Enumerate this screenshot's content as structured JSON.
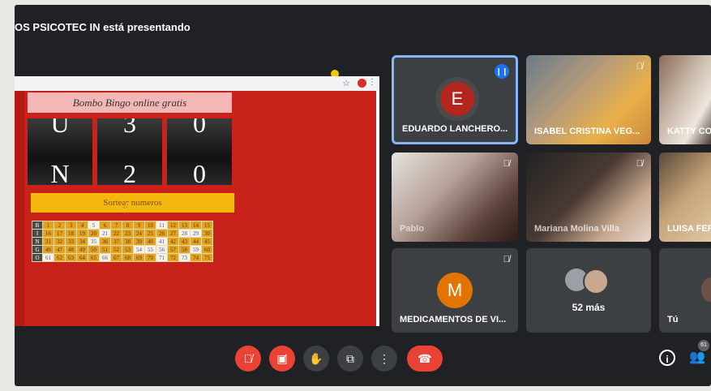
{
  "meet": {
    "presenting_text": "OS PSICOTEC IN está presentando",
    "people_count": "61"
  },
  "bingo": {
    "title": "Bombo Bingo online gratis",
    "balls_top": [
      "U",
      "3",
      "0"
    ],
    "balls_bottom": [
      "N",
      "2",
      "0"
    ],
    "draw_button": "Sortear numeros",
    "rows": [
      {
        "letter": "B",
        "nums": [
          "1",
          "2",
          "3",
          "4",
          "5",
          "6",
          "7",
          "8",
          "9",
          "10",
          "11",
          "12",
          "13",
          "14",
          "15"
        ]
      },
      {
        "letter": "I",
        "nums": [
          "16",
          "17",
          "18",
          "19",
          "20",
          "21",
          "22",
          "23",
          "24",
          "25",
          "26",
          "27",
          "28",
          "29",
          "30"
        ]
      },
      {
        "letter": "N",
        "nums": [
          "31",
          "32",
          "33",
          "34",
          "35",
          "36",
          "37",
          "38",
          "39",
          "40",
          "41",
          "42",
          "43",
          "44",
          "45"
        ]
      },
      {
        "letter": "G",
        "nums": [
          "46",
          "47",
          "48",
          "49",
          "50",
          "51",
          "52",
          "53",
          "54",
          "55",
          "56",
          "57",
          "58",
          "59",
          "60"
        ]
      },
      {
        "letter": "O",
        "nums": [
          "61",
          "62",
          "63",
          "64",
          "65",
          "66",
          "67",
          "68",
          "69",
          "70",
          "71",
          "72",
          "73",
          "74",
          "75"
        ]
      }
    ]
  },
  "participants": [
    {
      "name": "EDUARDO LANCHERO...",
      "initial": "E",
      "color": "#b3261e"
    },
    {
      "name": "ISABEL CRISTINA VEG..."
    },
    {
      "name": "KATTY CO"
    },
    {
      "name": "Pablo"
    },
    {
      "name": "Mariana Molina Villa"
    },
    {
      "name": "LUISA FER"
    },
    {
      "name": "MEDICAMENTOS DE VI...",
      "initial": "M",
      "color": "#e37400"
    }
  ],
  "more": {
    "label": "52 más"
  },
  "self": {
    "label": "Tú"
  },
  "controls": {
    "mic": "mic-off-icon",
    "camera": "camera-off-icon",
    "hand": "raise-hand-icon",
    "present": "present-screen-icon",
    "more": "more-options-icon",
    "end": "end-call-icon",
    "info": "info-icon",
    "people": "people-icon"
  }
}
